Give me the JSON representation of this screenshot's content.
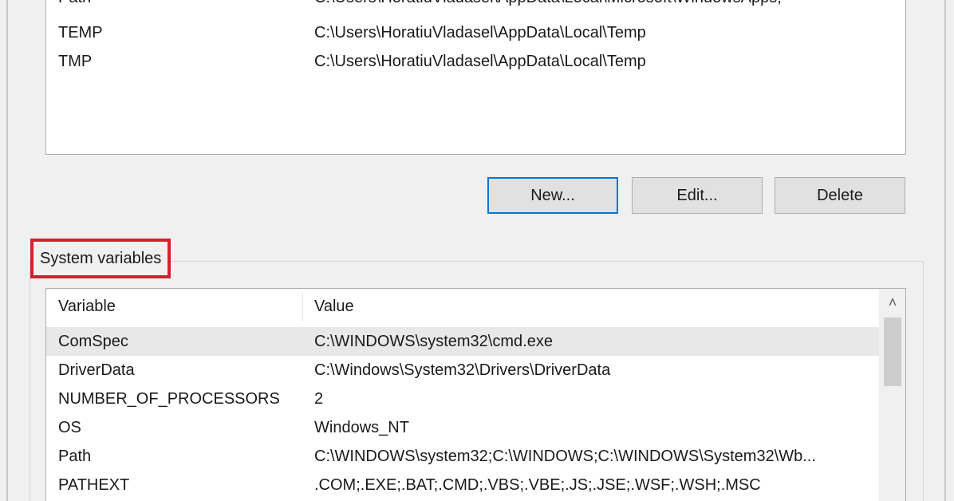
{
  "user_variables": {
    "rows": [
      {
        "variable": "Path",
        "value": "C:\\Users\\HoratiuVladasel\\AppData\\Local\\Microsoft\\WindowsApps;"
      },
      {
        "variable": "TEMP",
        "value": "C:\\Users\\HoratiuVladasel\\AppData\\Local\\Temp"
      },
      {
        "variable": "TMP",
        "value": "C:\\Users\\HoratiuVladasel\\AppData\\Local\\Temp"
      }
    ],
    "buttons": {
      "new": "New...",
      "edit": "Edit...",
      "delete": "Delete"
    }
  },
  "system_variables": {
    "title": "System variables",
    "highlight_color": "#d4202e",
    "columns": {
      "variable": "Variable",
      "value": "Value"
    },
    "rows": [
      {
        "variable": "ComSpec",
        "value": "C:\\WINDOWS\\system32\\cmd.exe",
        "selected": true
      },
      {
        "variable": "DriverData",
        "value": "C:\\Windows\\System32\\Drivers\\DriverData"
      },
      {
        "variable": "NUMBER_OF_PROCESSORS",
        "value": "2"
      },
      {
        "variable": "OS",
        "value": "Windows_NT"
      },
      {
        "variable": "Path",
        "value": "C:\\WINDOWS\\system32;C:\\WINDOWS;C:\\WINDOWS\\System32\\Wb..."
      },
      {
        "variable": "PATHEXT",
        "value": ".COM;.EXE;.BAT;.CMD;.VBS;.VBE;.JS;.JSE;.WSF;.WSH;.MSC"
      }
    ],
    "scroll_up_icon": "chevron-up-icon"
  }
}
